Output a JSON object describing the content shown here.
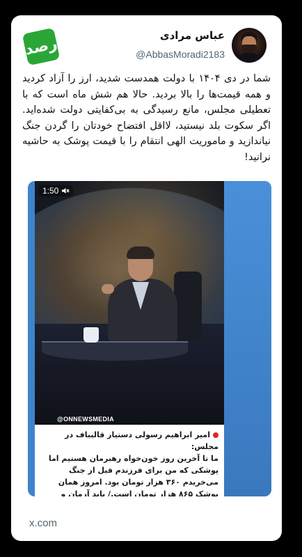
{
  "author": {
    "name": "عباس مرادی",
    "handle": "@AbbasMoradi2183"
  },
  "logo": {
    "icon": "rasad-logo-icon",
    "text": "رصد",
    "color": "#2aa637"
  },
  "tweet": {
    "text": "شما در دی ۱۴۰۴ با دولت همدست شدید، ارز را آزاد کردید و همه قیمت‌ها را بالا بردید. حالا هم شش ماه است که با تعطیلی مجلس، مانع رسیدگی به بی‌کفایتی دولت شده‌اید. اگر سکوت بلد نیستید، لااقل افتضاح خودتان را گردن جنگ نیاندازید و ماموریت الهی انتقام را با قیمت پوشک به حاشیه نرانید!"
  },
  "media": {
    "timer": "1:50",
    "mute_icon": "speaker-muted-icon",
    "watermark": "@ONNEWSMEDIA",
    "caption_title": "امیر ابراهیم رسولی دستیار قالیباف در مجلس:",
    "caption_body": "ما تا آخرین روز خون‌خواه رهبرمان هستیم اما پوشکی که من برای فرزندم قبل از جنگ می‌خریدم ۳۶۰ هزار تومان بود. امروز همان پوشک ۸۶۵ هزار تومان است./ باید آرمان و شعار را با واقعیات جامعه تطابق بدهیم.",
    "accent_color": "#e0262a"
  },
  "footer": {
    "source": "x.com"
  }
}
